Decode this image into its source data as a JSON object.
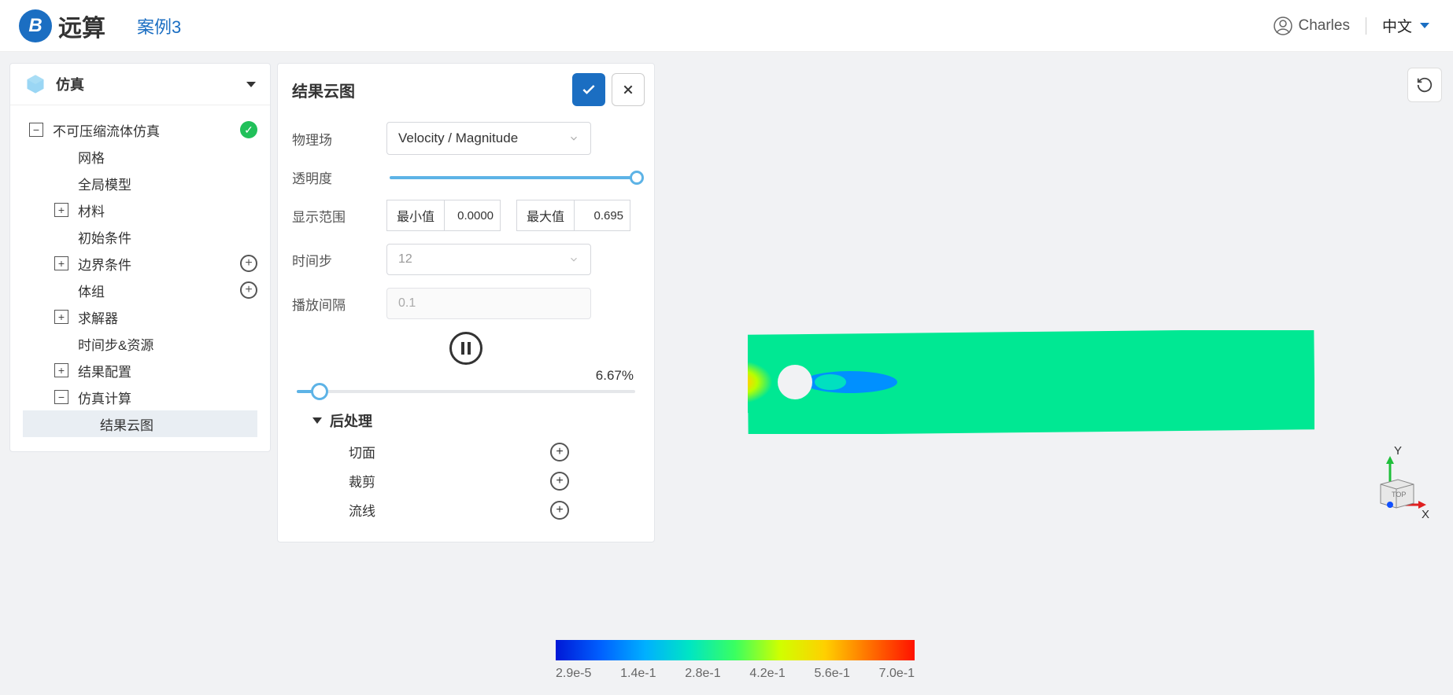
{
  "header": {
    "brand": "远算",
    "breadcrumb": "案例3",
    "user": "Charles",
    "language": "中文"
  },
  "tree": {
    "title": "仿真",
    "root": "不可压缩流体仿真",
    "items": {
      "mesh": "网格",
      "global_model": "全局模型",
      "materials": "材料",
      "initial": "初始条件",
      "boundary": "边界条件",
      "groups": "体组",
      "solver": "求解器",
      "timestep": "时间步&资源",
      "result_cfg": "结果配置",
      "sim_compute": "仿真计算",
      "result_cloud": "结果云图"
    }
  },
  "settings": {
    "title": "结果云图",
    "labels": {
      "field": "物理场",
      "opacity": "透明度",
      "range": "显示范围",
      "min": "最小值",
      "max": "最大值",
      "timestep": "时间步",
      "interval": "播放间隔"
    },
    "field_value": "Velocity / Magnitude",
    "min_value": "0.0000",
    "max_value": "0.695",
    "timestep_value": "12",
    "interval_value": "0.1",
    "progress": "6.67%",
    "post": {
      "title": "后处理",
      "slice": "切面",
      "clip": "裁剪",
      "streamline": "流线"
    }
  },
  "colorbar": {
    "ticks": [
      "2.9e-5",
      "1.4e-1",
      "2.8e-1",
      "4.2e-1",
      "5.6e-1",
      "7.0e-1"
    ]
  },
  "axis": {
    "y": "Y",
    "x": "X",
    "top": "TOP"
  }
}
